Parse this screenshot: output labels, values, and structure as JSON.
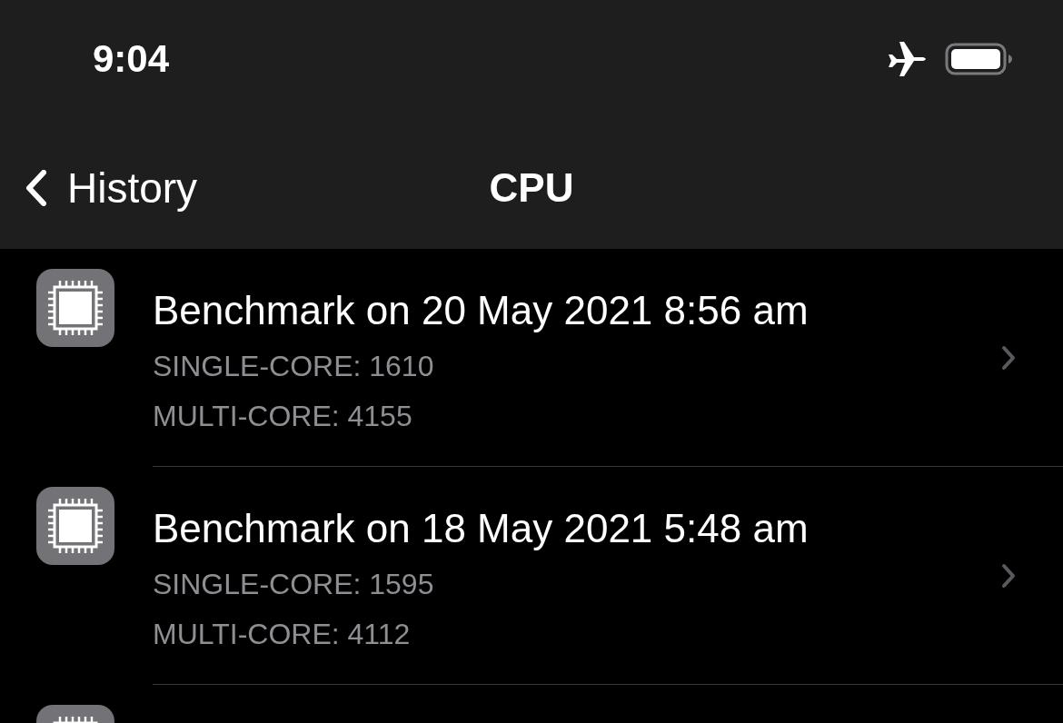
{
  "status_bar": {
    "time": "9:04",
    "airplane_mode": true
  },
  "nav": {
    "back_label": "History",
    "title": "CPU"
  },
  "rows": [
    {
      "title": "Benchmark on 20 May 2021 8:56 am",
      "lines": [
        "SINGLE-CORE: 1610",
        "MULTI-CORE: 4155"
      ]
    },
    {
      "title": "Benchmark on 18 May 2021 5:48 am",
      "lines": [
        "SINGLE-CORE: 1595",
        "MULTI-CORE: 4112"
      ]
    }
  ],
  "partial_row_below": true
}
